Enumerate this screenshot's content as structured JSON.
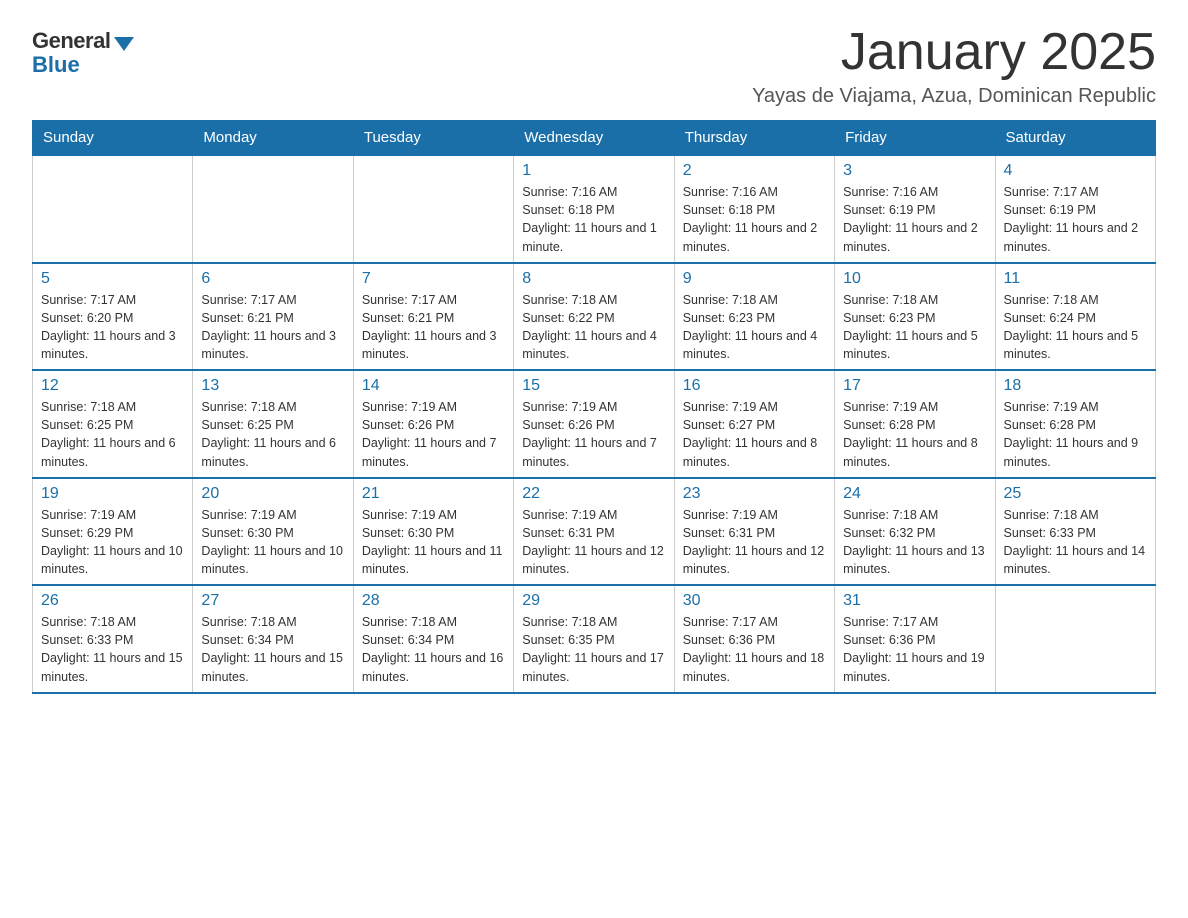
{
  "logo": {
    "general": "General",
    "blue": "Blue"
  },
  "title": "January 2025",
  "subtitle": "Yayas de Viajama, Azua, Dominican Republic",
  "days_of_week": [
    "Sunday",
    "Monday",
    "Tuesday",
    "Wednesday",
    "Thursday",
    "Friday",
    "Saturday"
  ],
  "weeks": [
    [
      {
        "day": "",
        "info": ""
      },
      {
        "day": "",
        "info": ""
      },
      {
        "day": "",
        "info": ""
      },
      {
        "day": "1",
        "info": "Sunrise: 7:16 AM\nSunset: 6:18 PM\nDaylight: 11 hours and 1 minute."
      },
      {
        "day": "2",
        "info": "Sunrise: 7:16 AM\nSunset: 6:18 PM\nDaylight: 11 hours and 2 minutes."
      },
      {
        "day": "3",
        "info": "Sunrise: 7:16 AM\nSunset: 6:19 PM\nDaylight: 11 hours and 2 minutes."
      },
      {
        "day": "4",
        "info": "Sunrise: 7:17 AM\nSunset: 6:19 PM\nDaylight: 11 hours and 2 minutes."
      }
    ],
    [
      {
        "day": "5",
        "info": "Sunrise: 7:17 AM\nSunset: 6:20 PM\nDaylight: 11 hours and 3 minutes."
      },
      {
        "day": "6",
        "info": "Sunrise: 7:17 AM\nSunset: 6:21 PM\nDaylight: 11 hours and 3 minutes."
      },
      {
        "day": "7",
        "info": "Sunrise: 7:17 AM\nSunset: 6:21 PM\nDaylight: 11 hours and 3 minutes."
      },
      {
        "day": "8",
        "info": "Sunrise: 7:18 AM\nSunset: 6:22 PM\nDaylight: 11 hours and 4 minutes."
      },
      {
        "day": "9",
        "info": "Sunrise: 7:18 AM\nSunset: 6:23 PM\nDaylight: 11 hours and 4 minutes."
      },
      {
        "day": "10",
        "info": "Sunrise: 7:18 AM\nSunset: 6:23 PM\nDaylight: 11 hours and 5 minutes."
      },
      {
        "day": "11",
        "info": "Sunrise: 7:18 AM\nSunset: 6:24 PM\nDaylight: 11 hours and 5 minutes."
      }
    ],
    [
      {
        "day": "12",
        "info": "Sunrise: 7:18 AM\nSunset: 6:25 PM\nDaylight: 11 hours and 6 minutes."
      },
      {
        "day": "13",
        "info": "Sunrise: 7:18 AM\nSunset: 6:25 PM\nDaylight: 11 hours and 6 minutes."
      },
      {
        "day": "14",
        "info": "Sunrise: 7:19 AM\nSunset: 6:26 PM\nDaylight: 11 hours and 7 minutes."
      },
      {
        "day": "15",
        "info": "Sunrise: 7:19 AM\nSunset: 6:26 PM\nDaylight: 11 hours and 7 minutes."
      },
      {
        "day": "16",
        "info": "Sunrise: 7:19 AM\nSunset: 6:27 PM\nDaylight: 11 hours and 8 minutes."
      },
      {
        "day": "17",
        "info": "Sunrise: 7:19 AM\nSunset: 6:28 PM\nDaylight: 11 hours and 8 minutes."
      },
      {
        "day": "18",
        "info": "Sunrise: 7:19 AM\nSunset: 6:28 PM\nDaylight: 11 hours and 9 minutes."
      }
    ],
    [
      {
        "day": "19",
        "info": "Sunrise: 7:19 AM\nSunset: 6:29 PM\nDaylight: 11 hours and 10 minutes."
      },
      {
        "day": "20",
        "info": "Sunrise: 7:19 AM\nSunset: 6:30 PM\nDaylight: 11 hours and 10 minutes."
      },
      {
        "day": "21",
        "info": "Sunrise: 7:19 AM\nSunset: 6:30 PM\nDaylight: 11 hours and 11 minutes."
      },
      {
        "day": "22",
        "info": "Sunrise: 7:19 AM\nSunset: 6:31 PM\nDaylight: 11 hours and 12 minutes."
      },
      {
        "day": "23",
        "info": "Sunrise: 7:19 AM\nSunset: 6:31 PM\nDaylight: 11 hours and 12 minutes."
      },
      {
        "day": "24",
        "info": "Sunrise: 7:18 AM\nSunset: 6:32 PM\nDaylight: 11 hours and 13 minutes."
      },
      {
        "day": "25",
        "info": "Sunrise: 7:18 AM\nSunset: 6:33 PM\nDaylight: 11 hours and 14 minutes."
      }
    ],
    [
      {
        "day": "26",
        "info": "Sunrise: 7:18 AM\nSunset: 6:33 PM\nDaylight: 11 hours and 15 minutes."
      },
      {
        "day": "27",
        "info": "Sunrise: 7:18 AM\nSunset: 6:34 PM\nDaylight: 11 hours and 15 minutes."
      },
      {
        "day": "28",
        "info": "Sunrise: 7:18 AM\nSunset: 6:34 PM\nDaylight: 11 hours and 16 minutes."
      },
      {
        "day": "29",
        "info": "Sunrise: 7:18 AM\nSunset: 6:35 PM\nDaylight: 11 hours and 17 minutes."
      },
      {
        "day": "30",
        "info": "Sunrise: 7:17 AM\nSunset: 6:36 PM\nDaylight: 11 hours and 18 minutes."
      },
      {
        "day": "31",
        "info": "Sunrise: 7:17 AM\nSunset: 6:36 PM\nDaylight: 11 hours and 19 minutes."
      },
      {
        "day": "",
        "info": ""
      }
    ]
  ],
  "colors": {
    "header_bg": "#1a6fa8",
    "header_text": "#ffffff",
    "day_number_color": "#1a6fa8",
    "border_color": "#cccccc",
    "row_border": "#1a6fa8"
  }
}
